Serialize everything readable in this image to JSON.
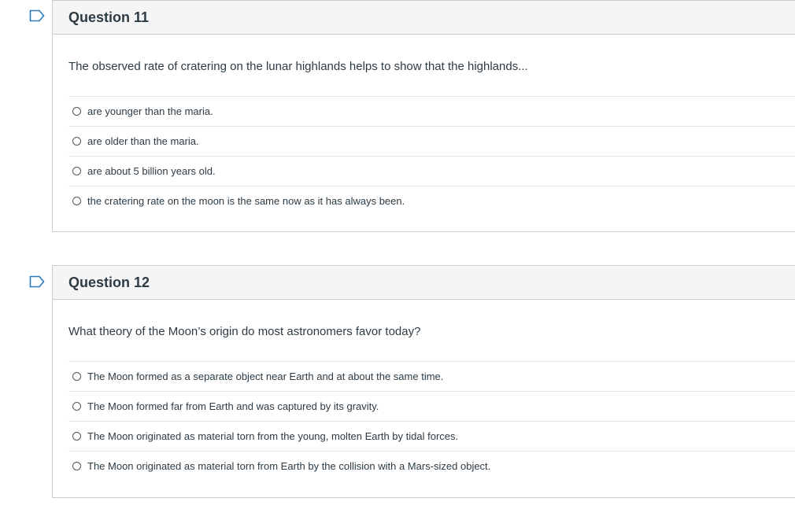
{
  "questions": [
    {
      "title": "Question 11",
      "text": "The observed rate of cratering on the lunar highlands helps to show that the highlands...",
      "answers": [
        "are younger than the maria.",
        "are older than the maria.",
        "are about 5 billion years old.",
        "the cratering rate on the moon is the same now as it has always been."
      ]
    },
    {
      "title": "Question 12",
      "text": "What theory of the Moon’s origin do most astronomers favor today?",
      "answers": [
        "The Moon formed as a separate object near Earth and at about the same time.",
        "The Moon formed far from Earth and was captured by its gravity.",
        "The Moon originated as material torn from the young, molten Earth by tidal forces.",
        "The Moon originated as material torn from Earth by the collision with a Mars-sized object."
      ]
    }
  ],
  "icons": {
    "flag": "flag-question-icon"
  },
  "colors": {
    "flag": "#2b7abc",
    "header_bg": "#f5f5f5",
    "border": "#c7cdd1"
  }
}
